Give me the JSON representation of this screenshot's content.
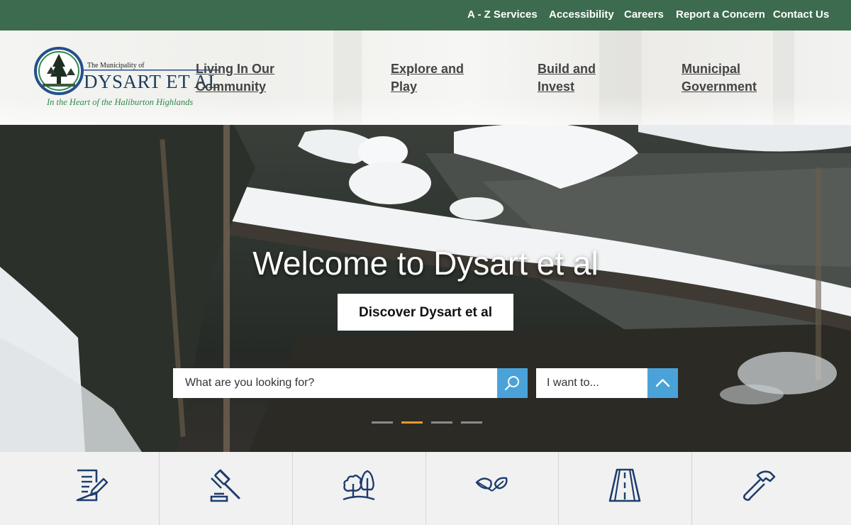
{
  "utility_nav": [
    {
      "label": "A - Z Services"
    },
    {
      "label": "Accessibility"
    },
    {
      "label": "Careers"
    },
    {
      "label": "Report a Concern"
    },
    {
      "label": "Contact Us"
    }
  ],
  "logo": {
    "top_line": "The Municipality of",
    "name": "DYSART ET AL",
    "tagline": "In the Heart of the Haliburton Highlands"
  },
  "main_nav": [
    {
      "line1": "Living In Our",
      "line2": "Community"
    },
    {
      "line1": "Explore and",
      "line2": "Play"
    },
    {
      "line1": "Build and",
      "line2": "Invest"
    },
    {
      "line1": "Municipal",
      "line2": "Government"
    }
  ],
  "hero": {
    "title": "Welcome to Dysart et al",
    "button_label": "Discover Dysart et al",
    "search_placeholder": "What are you looking for?",
    "want_label": "I want to...",
    "slide_count": 4,
    "active_slide": 2
  },
  "quick_link_icons": [
    "document-edit-icon",
    "gavel-icon",
    "trees-icon",
    "leaves-icon",
    "road-icon",
    "hammer-icon"
  ],
  "colors": {
    "utility_bg": "#3d6b4f",
    "accent_blue": "#4aa3d8",
    "icon_navy": "#1d3d6e",
    "active_dot": "#e89a2d"
  }
}
